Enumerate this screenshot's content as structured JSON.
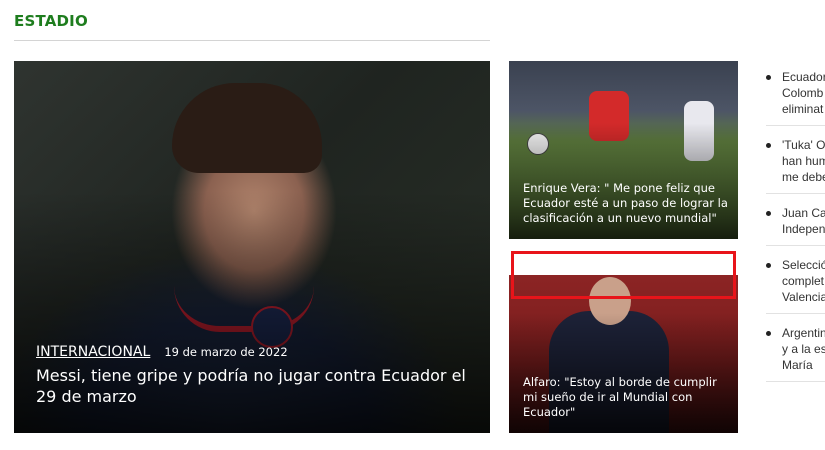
{
  "section": {
    "title": "ESTADIO",
    "accent_color": "#1e7d1e"
  },
  "main_story": {
    "category": "INTERNACIONAL",
    "date": "19 de marzo de 2022",
    "headline": "Messi, tiene gripe y podría no jugar contra Ecuador el 29 de marzo"
  },
  "side_stories": [
    {
      "caption": "Enrique Vera: \" Me pone feliz que Ecuador esté a un paso de lograr la clasificación a un nuevo mundial\""
    },
    {
      "caption": "Alfaro: \"Estoy al borde de cumplir mi sueño de ir al Mundial con Ecuador\""
    }
  ],
  "highlight_color": "#e8141a",
  "side_list": [
    {
      "text": "Ecuador\nColomb\neliminat"
    },
    {
      "text": "'Tuka' Or\nhan hum\nme debe"
    },
    {
      "text": "Juan Ca\nIndepen"
    },
    {
      "text": "Selecció\ncomplet\nValencia"
    },
    {
      "text": "Argentin\ny a la es\nMaría"
    }
  ]
}
